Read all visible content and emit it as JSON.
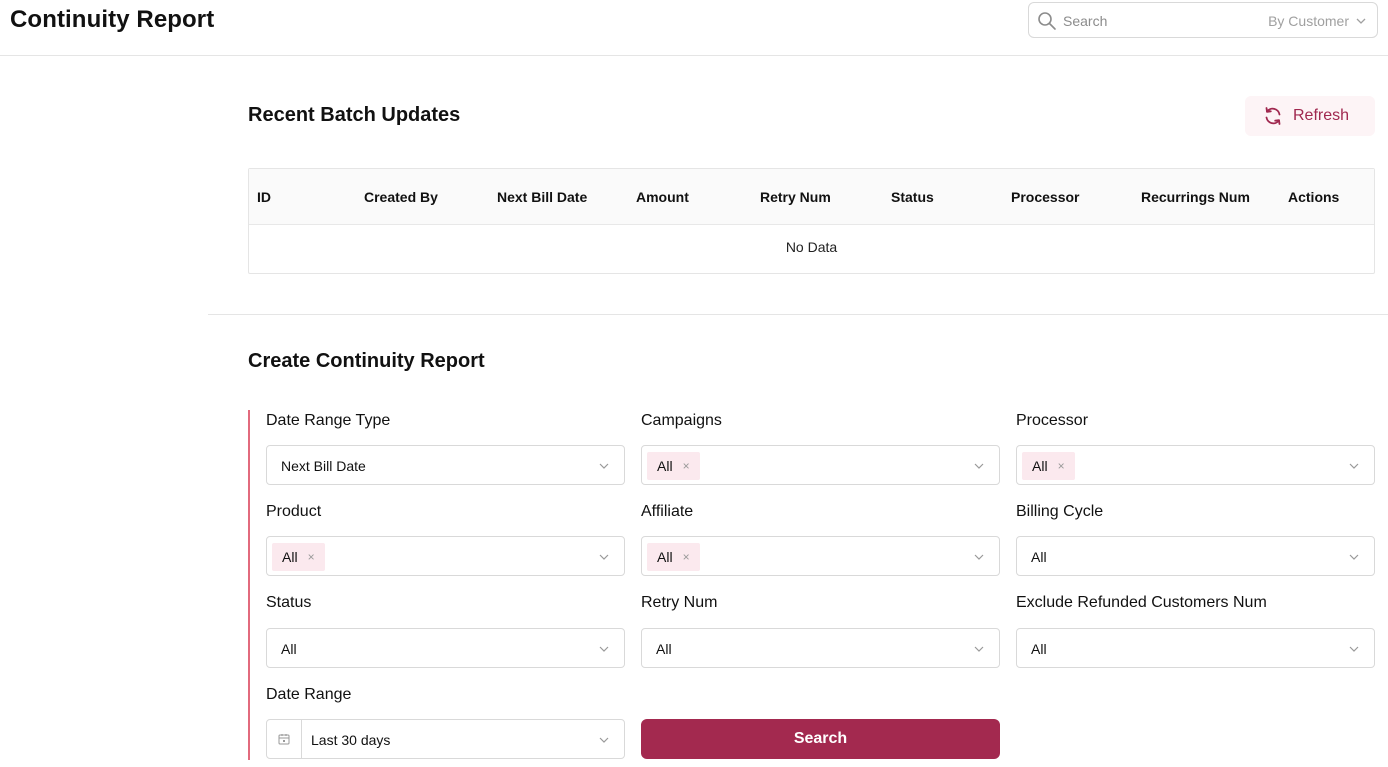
{
  "header": {
    "title": "Continuity Report",
    "search_placeholder": "Search",
    "search_scope": "By Customer"
  },
  "batch": {
    "title": "Recent Batch Updates",
    "refresh_label": "Refresh",
    "columns": [
      "ID",
      "Created By",
      "Next Bill Date",
      "Amount",
      "Retry Num",
      "Status",
      "Processor",
      "Recurrings Num",
      "Actions"
    ],
    "empty_text": "No Data"
  },
  "form": {
    "title": "Create Continuity Report",
    "date_range_type": {
      "label": "Date Range Type",
      "value": "Next Bill Date"
    },
    "campaigns": {
      "label": "Campaigns",
      "tag": "All"
    },
    "processor": {
      "label": "Processor",
      "tag": "All"
    },
    "product": {
      "label": "Product",
      "tag": "All"
    },
    "affiliate": {
      "label": "Affiliate",
      "tag": "All"
    },
    "billing_cycle": {
      "label": "Billing Cycle",
      "value": "All"
    },
    "status": {
      "label": "Status",
      "value": "All"
    },
    "retry_num": {
      "label": "Retry Num",
      "value": "All"
    },
    "exclude_refunded": {
      "label": "Exclude Refunded Customers Num",
      "value": "All"
    },
    "date_range": {
      "label": "Date Range",
      "value": "Last 30 days"
    },
    "search_label": "Search",
    "tag_close": "×"
  },
  "colors": {
    "accent": "#a3294f",
    "accent_light": "#fbe9ee",
    "form_bar": "#e26a7d"
  },
  "icons": {
    "search": "search-icon",
    "refresh": "refresh-icon",
    "chevron": "chevron-down-icon",
    "calendar": "calendar-icon"
  }
}
